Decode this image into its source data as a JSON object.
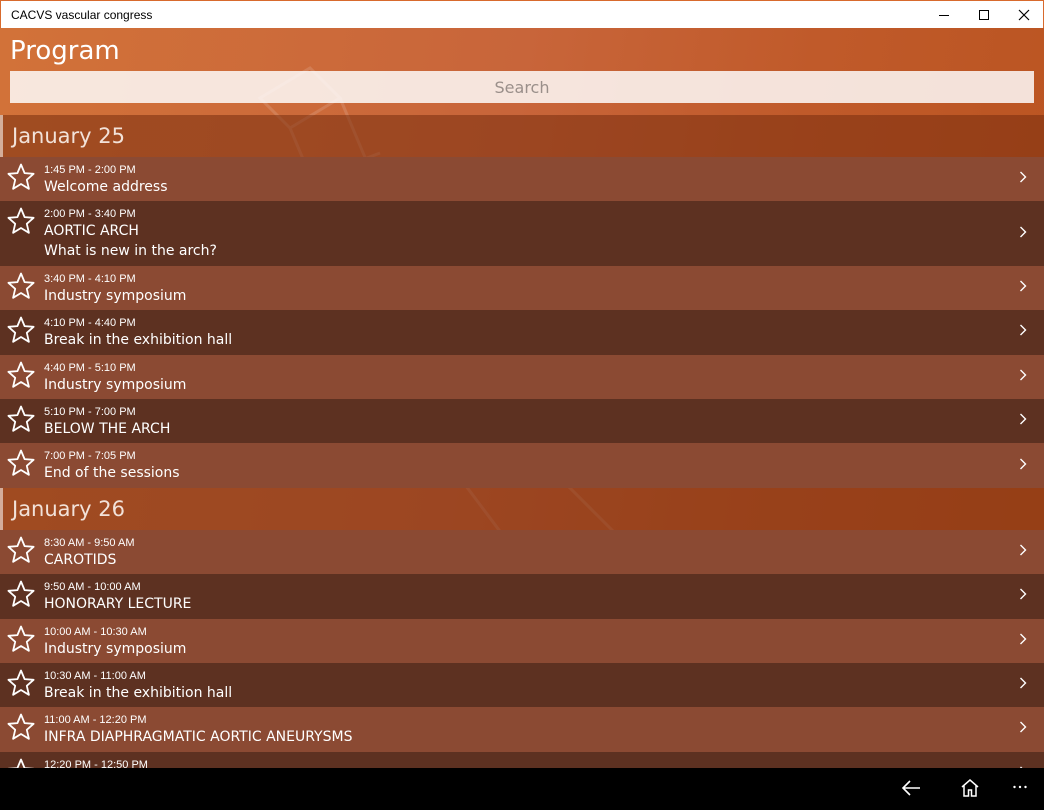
{
  "window": {
    "title": "CACVS vascular congress",
    "controls": [
      "minimize-icon",
      "maximize-icon",
      "close-icon"
    ]
  },
  "page": {
    "title": "Program",
    "search_placeholder": "Search"
  },
  "colors": {
    "accent": "#c8653a",
    "row_light": "#8b4a33",
    "row_dark": "#5d3121",
    "day_header": "#7a3a1f"
  },
  "days": [
    {
      "label": "January 25",
      "sessions": [
        {
          "time": "1:45 PM - 2:00 PM",
          "title": "Welcome address",
          "subtitle": ""
        },
        {
          "time": "2:00 PM - 3:40 PM",
          "title": "AORTIC ARCH",
          "subtitle": "What is new in the arch?"
        },
        {
          "time": "3:40 PM - 4:10 PM",
          "title": "Industry symposium",
          "subtitle": ""
        },
        {
          "time": "4:10 PM - 4:40 PM",
          "title": "Break in the exhibition hall",
          "subtitle": ""
        },
        {
          "time": "4:40 PM - 5:10 PM",
          "title": "Industry symposium",
          "subtitle": ""
        },
        {
          "time": "5:10 PM - 7:00 PM",
          "title": "BELOW THE ARCH",
          "subtitle": ""
        },
        {
          "time": "7:00 PM - 7:05 PM",
          "title": "End of the sessions",
          "subtitle": ""
        }
      ]
    },
    {
      "label": "January 26",
      "sessions": [
        {
          "time": "8:30 AM - 9:50 AM",
          "title": "CAROTIDS",
          "subtitle": ""
        },
        {
          "time": "9:50 AM - 10:00 AM",
          "title": "HONORARY LECTURE",
          "subtitle": ""
        },
        {
          "time": "10:00 AM - 10:30 AM",
          "title": "Industry symposium",
          "subtitle": ""
        },
        {
          "time": "10:30 AM - 11:00 AM",
          "title": "Break in the exhibition hall",
          "subtitle": ""
        },
        {
          "time": "11:00 AM - 12:20 PM",
          "title": "INFRA DIAPHRAGMATIC AORTIC ANEURYSMS",
          "subtitle": ""
        },
        {
          "time": "12:20 PM - 12:50 PM",
          "title": "",
          "subtitle": ""
        }
      ]
    }
  ],
  "row_icons": {
    "favorite": "star-outline-icon",
    "open": "chevron-right-icon"
  },
  "taskbar": {
    "icons": [
      "back-arrow-icon",
      "home-icon",
      "more-icon"
    ]
  }
}
